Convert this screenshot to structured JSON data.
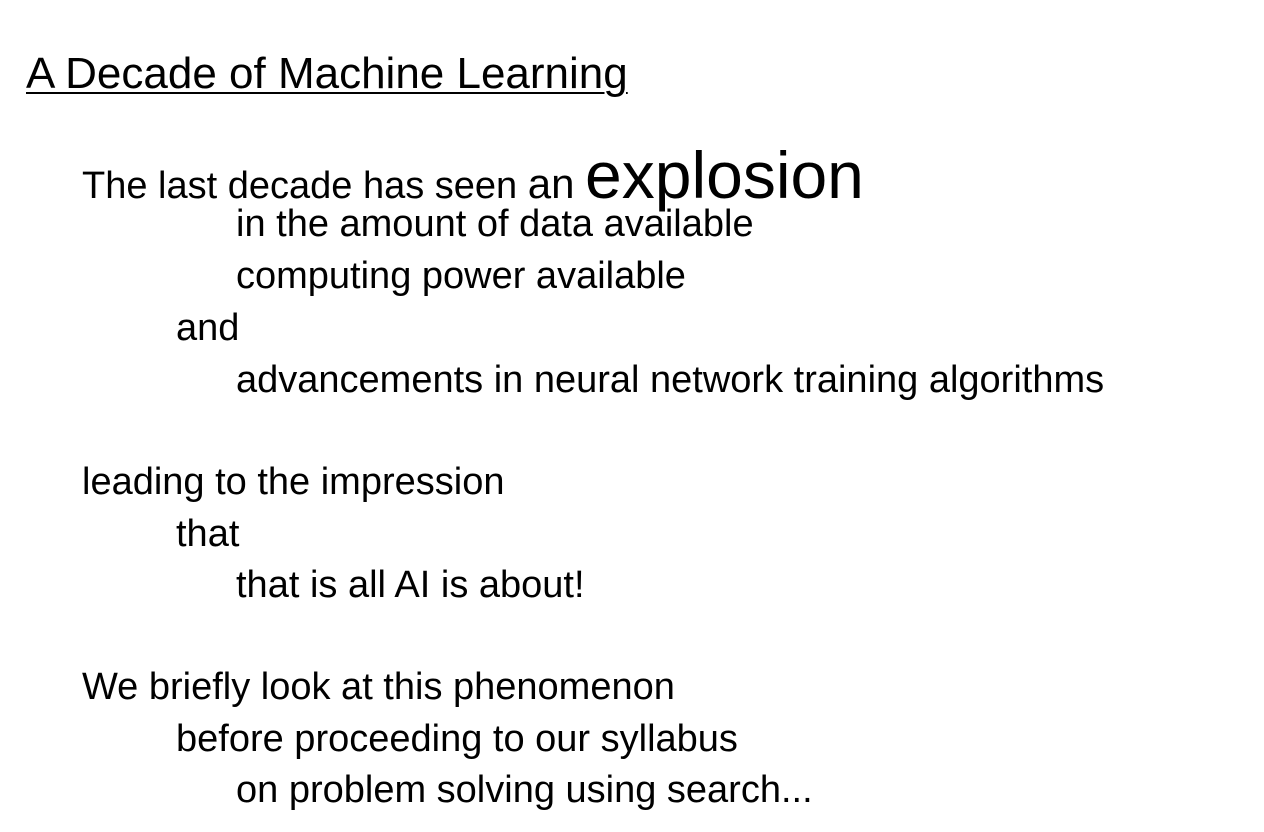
{
  "slide": {
    "title": "A Decade of Machine Learning",
    "lines": [
      {
        "text": "The last decade has seen ",
        "an": "an",
        "big": "explosion"
      },
      {
        "text": "in the amount of data available"
      },
      {
        "text": "computing power available"
      },
      {
        "text": "and"
      },
      {
        "text": "advancements in neural network training algorithms"
      },
      {
        "text": "leading to the impression"
      },
      {
        "text": "that"
      },
      {
        "text": "that is all AI is about!"
      },
      {
        "text": "We briefly look at this phenomenon"
      },
      {
        "text": "before proceeding to our syllabus"
      },
      {
        "text": "on problem solving using search..."
      }
    ]
  }
}
